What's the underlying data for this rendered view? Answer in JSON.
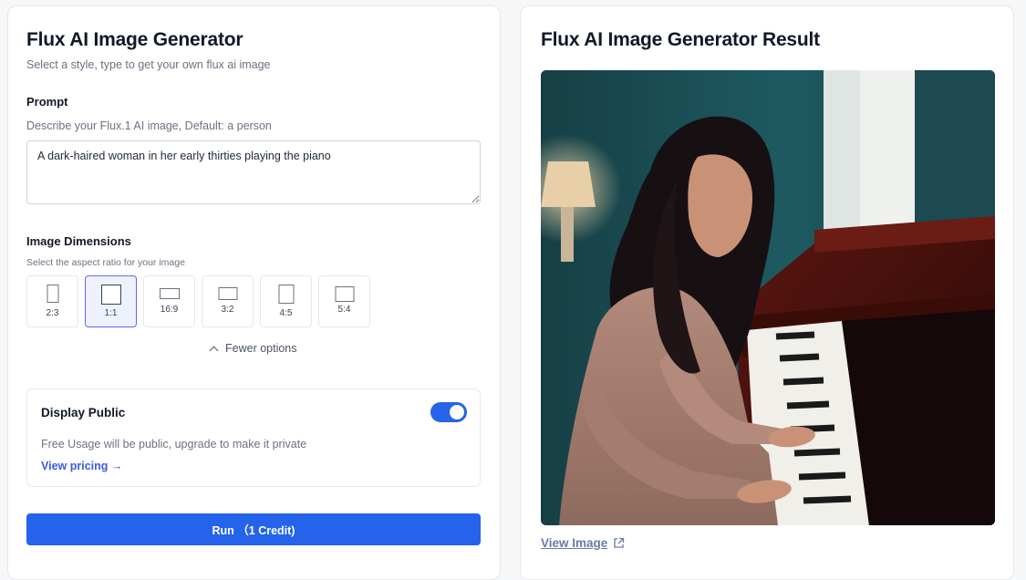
{
  "form": {
    "title": "Flux AI Image Generator",
    "subtitle": "Select a style, type to get your own flux ai image",
    "prompt_label": "Prompt",
    "prompt_hint": "Describe your Flux.1 AI image, Default: a person",
    "prompt_value": "A dark-haired woman in her early thirties playing the piano",
    "dimensions_label": "Image Dimensions",
    "dimensions_hint": "Select the aspect ratio for your image",
    "ratios": [
      {
        "label": "2:3",
        "selected": false
      },
      {
        "label": "1:1",
        "selected": true
      },
      {
        "label": "16:9",
        "selected": false
      },
      {
        "label": "3:2",
        "selected": false
      },
      {
        "label": "4:5",
        "selected": false
      },
      {
        "label": "5:4",
        "selected": false
      }
    ],
    "fewer_options": "Fewer options",
    "public_panel": {
      "title": "Display Public",
      "toggle_on": true,
      "description": "Free Usage will be public, upgrade to make it private",
      "link": "View pricing →"
    },
    "run_button": "Run （1 Credit)"
  },
  "result": {
    "title": "Flux AI Image Generator Result",
    "view_image": "View Image"
  },
  "colors": {
    "accent": "#2563eb",
    "selected_bg": "#eef2ff",
    "selected_border": "#6366f1"
  },
  "icons": {
    "fewer_options": "chevron-up-icon",
    "view_image": "external-link-icon"
  }
}
